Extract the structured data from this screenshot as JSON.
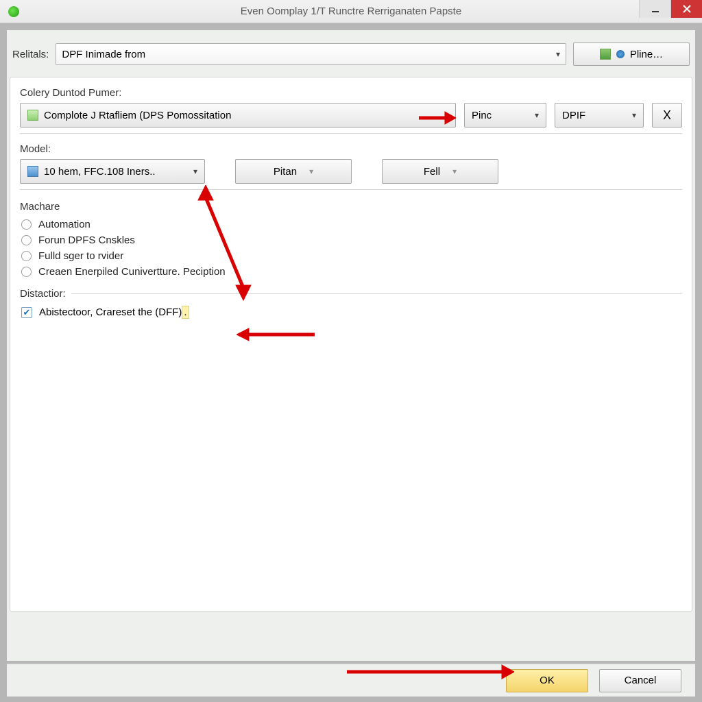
{
  "colors": {
    "accent_red": "#d80000",
    "ok_yellow": "#f3d46b",
    "close_red": "#ce3434"
  },
  "titlebar": {
    "title": "Even Oomplay 1/T Runctre Rerriganaten Papste"
  },
  "relitals": {
    "label": "Relitals:",
    "value": "DPF Inimade from",
    "pline_label": "Pline…"
  },
  "group": {
    "label": "Colery Duntod Pumer:",
    "process": {
      "value": "Complote J Rtafliem (DPS Pomossitation"
    },
    "pinc": {
      "value": "Pinc"
    },
    "dpif": {
      "value": "DPIF"
    },
    "close_x": "X",
    "model_label": "Model:",
    "model": {
      "value": "10 hem, FFC.108 Iners.."
    },
    "pitan": {
      "label": "Pitan"
    },
    "fell": {
      "label": "Fell"
    }
  },
  "machare": {
    "heading": "Machare",
    "options": [
      "Automation",
      "Forun DPFS Cnskles",
      "Fulld sger to rvider",
      "Creaen Enerpiled Cunivertture. Peciption"
    ]
  },
  "distaction": {
    "heading": "Distactior:",
    "check_label_part1": "Abistectoor, Crareset the (DFF)",
    "check_label_part2": ".",
    "checked": true
  },
  "footer": {
    "ok": "OK",
    "cancel": "Cancel"
  }
}
